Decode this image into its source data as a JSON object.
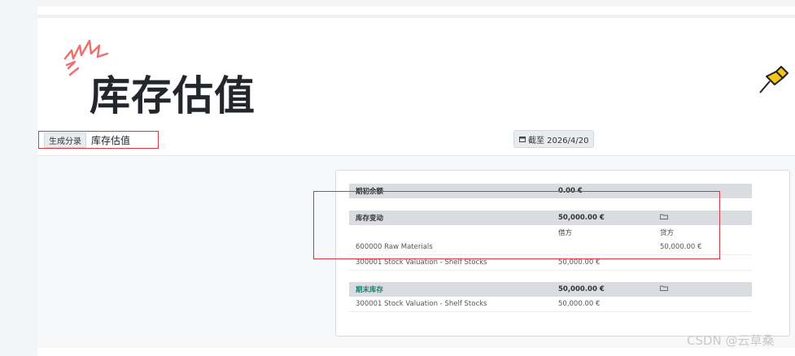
{
  "title": "库存估值",
  "breadcrumb": {
    "button": "生成分录",
    "current": "库存估值"
  },
  "date_filter": "截至 2026/4/20",
  "report": {
    "opening": {
      "label": "期初余额",
      "amount": "0.00 €"
    },
    "movement": {
      "label": "库存变动",
      "amount": "50,000.00 €",
      "col_debit": "借方",
      "col_credit": "贷方",
      "lines": [
        {
          "account": "600000 Raw Materials",
          "debit": "",
          "credit": "50,000.00 €"
        },
        {
          "account": "300001 Stock Valuation - Shelf Stocks",
          "debit": "50,000.00 €",
          "credit": ""
        }
      ]
    },
    "closing": {
      "label": "期末库存",
      "amount": "50,000.00 €",
      "lines": [
        {
          "account": "300001 Stock Valuation - Shelf Stocks",
          "debit": "50,000.00 €"
        }
      ]
    }
  },
  "watermark": "CSDN @云草桑",
  "colors": {
    "accent_red": "#d9363e",
    "teal": "#1e7b6f",
    "header_gray": "#d9dde1"
  }
}
